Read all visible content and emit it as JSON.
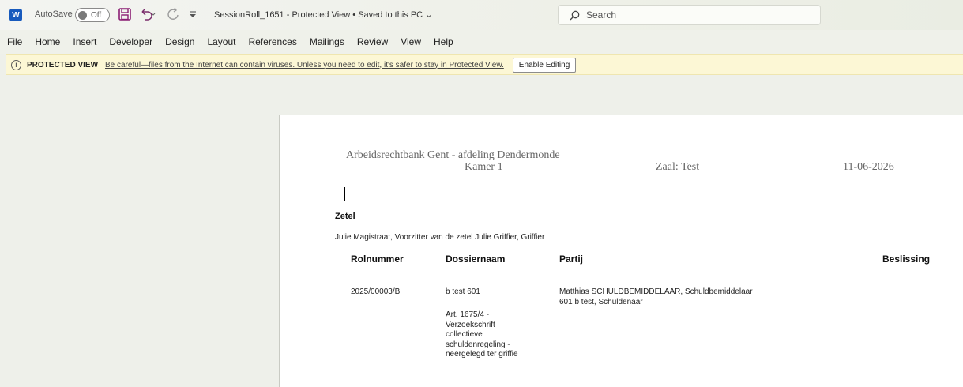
{
  "titlebar": {
    "autosave_label": "AutoSave",
    "autosave_state": "Off",
    "doc_title": "SessionRoll_1651  -  Protected View • Saved to this PC",
    "search_placeholder": "Search",
    "word_icon_letter": "W"
  },
  "ribbon": {
    "tabs": [
      "File",
      "Home",
      "Insert",
      "Developer",
      "Design",
      "Layout",
      "References",
      "Mailings",
      "Review",
      "View",
      "Help"
    ]
  },
  "protected_view": {
    "title": "PROTECTED VIEW",
    "message": "Be careful—files from the Internet can contain viruses. Unless you need to edit, it's safer to stay in Protected View.",
    "button": "Enable Editing"
  },
  "document": {
    "header": {
      "court": "Arbeidsrechtbank Gent - afdeling Dendermonde",
      "kamer": "Kamer 1",
      "zaal": "Zaal: Test",
      "date": "11-06-2026"
    },
    "zetel_heading": "Zetel",
    "zetel_members": "Julie Magistraat, Voorzitter van de zetel Julie Griffier, Griffier",
    "table": {
      "headers": [
        "Rolnummer",
        "Dossiernaam",
        "Partij",
        "Beslissing"
      ],
      "rows": [
        {
          "rolnummer": "2025/00003/B",
          "dossiernaam": "b test 601",
          "dossier_detail": [
            "Art. 1675/4 -",
            "Verzoekschrift",
            "collectieve",
            "schuldenregeling -",
            "neergelegd ter griffie"
          ],
          "partij": [
            "Matthias SCHULDBEMIDDELAAR, Schuldbemiddelaar",
            "601 b test, Schuldenaar"
          ]
        }
      ]
    }
  }
}
